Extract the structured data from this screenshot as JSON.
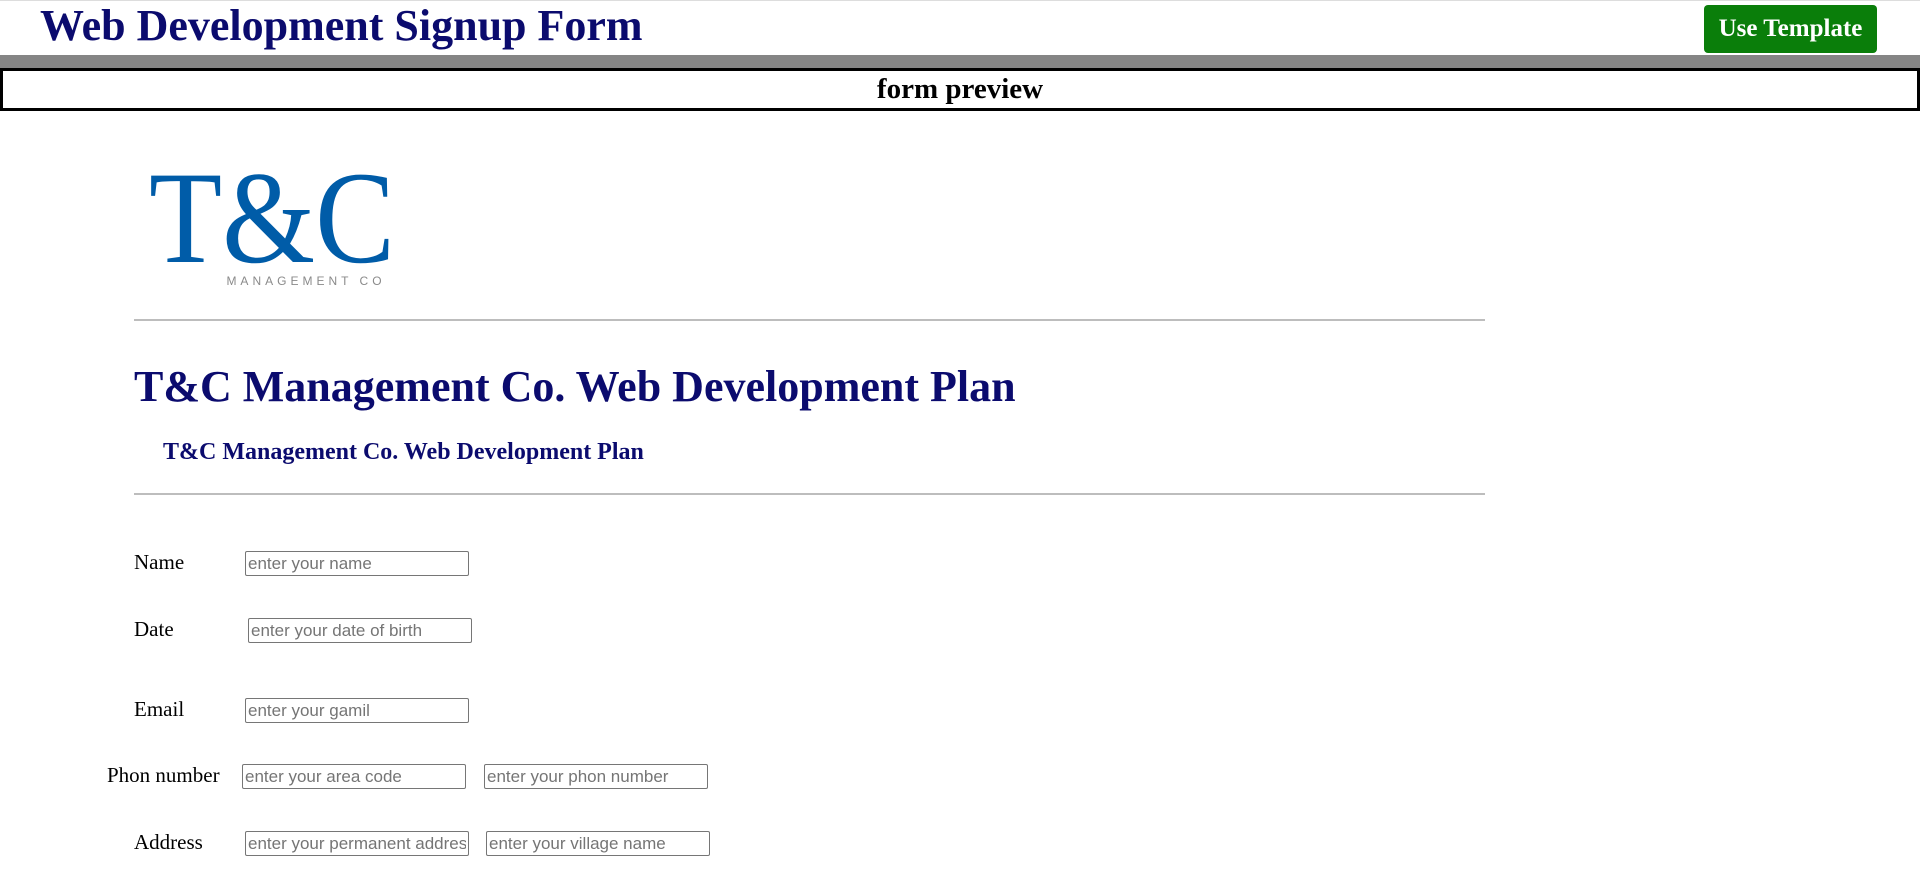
{
  "header": {
    "title": "Web Development Signup Form",
    "use_template_label": "Use Template",
    "button_color": "#0a7e0a",
    "title_color": "#0b0b6e"
  },
  "preview": {
    "label": "form preview"
  },
  "logo": {
    "letters": "T&C",
    "tagline": "MANAGEMENT CO",
    "color": "#005ca8"
  },
  "form": {
    "heading": "T&C Management Co. Web Development Plan",
    "subheading": "T&C Management Co. Web Development Plan",
    "fields": {
      "name": {
        "label": "Name",
        "placeholder": "enter your name",
        "value": ""
      },
      "date": {
        "label": "Date",
        "placeholder": "enter your date of birth",
        "value": ""
      },
      "email": {
        "label": "Email",
        "placeholder": "enter your gamil",
        "value": ""
      },
      "phone": {
        "label": "Phon number",
        "area_placeholder": "enter your area code",
        "number_placeholder": "enter your phon number",
        "area_value": "",
        "number_value": ""
      },
      "address": {
        "label": "Address",
        "permanent_placeholder": "enter your permanent address",
        "village_placeholder": "enter your village name",
        "permanent_value": "",
        "village_value": ""
      }
    }
  }
}
